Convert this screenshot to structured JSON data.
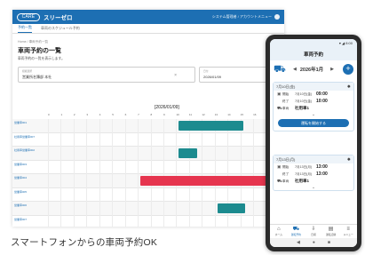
{
  "desktop": {
    "app": {
      "logo": "CARE",
      "title": "スリーゼロ",
      "user_text": "システム管理者 / アカウントメニュー"
    },
    "tabs": [
      "予約一覧",
      "車両のスケジュール予約"
    ],
    "breadcrumb": "Home / 車両予約一覧",
    "page_title": "車両予約の一覧",
    "page_desc": "車両予約の一覧を表示します。",
    "filter_org": {
      "label": "組織選択",
      "value": "営業所名簿部 本社",
      "clear": "×"
    },
    "filter_date": {
      "label": "日付",
      "value": "2026/01/09"
    },
    "gantt": {
      "date_label": "[2026/01/09]",
      "hours": [
        "0",
        "1",
        "2",
        "3",
        "4",
        "5",
        "6",
        "7",
        "8",
        "9",
        "10",
        "11",
        "12",
        "13",
        "14",
        "15",
        "16",
        "17"
      ],
      "rows": [
        "営業車001",
        "社用車営業車007",
        "社用車営業車002",
        "営業車003",
        "営業車004",
        "営業車005",
        "営業車006",
        "営業車007"
      ],
      "bars": [
        {
          "row": 0,
          "start": 10.2,
          "end": 15.2,
          "color": "#1c8b8f"
        },
        {
          "row": 2,
          "start": 10.2,
          "end": 11.6,
          "color": "#1c8b8f"
        },
        {
          "row": 4,
          "start": 7.2,
          "end": 18.5,
          "color": "#e6354f"
        },
        {
          "row": 6,
          "start": 13.2,
          "end": 15.4,
          "color": "#1c8b8f"
        }
      ]
    }
  },
  "caption": "スマートフォンからの車両予約OK",
  "phone": {
    "status": "▾ ◢ 8:00",
    "title": "車両予約",
    "month": "2026年1月",
    "prev_arrow": "◀",
    "next_arrow": "▶",
    "plus": "+",
    "card1": {
      "head": "7月10日(金)",
      "rows": [
        {
          "icon": "▣",
          "label": "開始",
          "date": "7月10日(金)",
          "time": "09:00"
        },
        {
          "icon": "",
          "label": "終了",
          "date": "7月10日(金)",
          "time": "10:00"
        },
        {
          "icon": "⛟",
          "label": "車両",
          "date": "",
          "time": "社用車1"
        }
      ],
      "button": "運転を開始する"
    },
    "card2": {
      "head": "7月13日(月)",
      "rows": [
        {
          "icon": "▣",
          "label": "開始",
          "date": "7月13日(月)",
          "time": "13:00"
        },
        {
          "icon": "",
          "label": "終了",
          "date": "7月13日(月)",
          "time": "13:00"
        },
        {
          "icon": "⛟",
          "label": "車両",
          "date": "",
          "time": "社用車1"
        }
      ]
    },
    "nav": [
      {
        "icon": "⌂",
        "label": "ホーム"
      },
      {
        "icon": "⛟",
        "label": "運転予約"
      },
      {
        "icon": "⇩",
        "label": "日報"
      },
      {
        "icon": "▤",
        "label": "運転記録"
      },
      {
        "icon": "≡",
        "label": "メニュー"
      }
    ],
    "homebar": [
      "◀",
      "●",
      "■"
    ]
  }
}
